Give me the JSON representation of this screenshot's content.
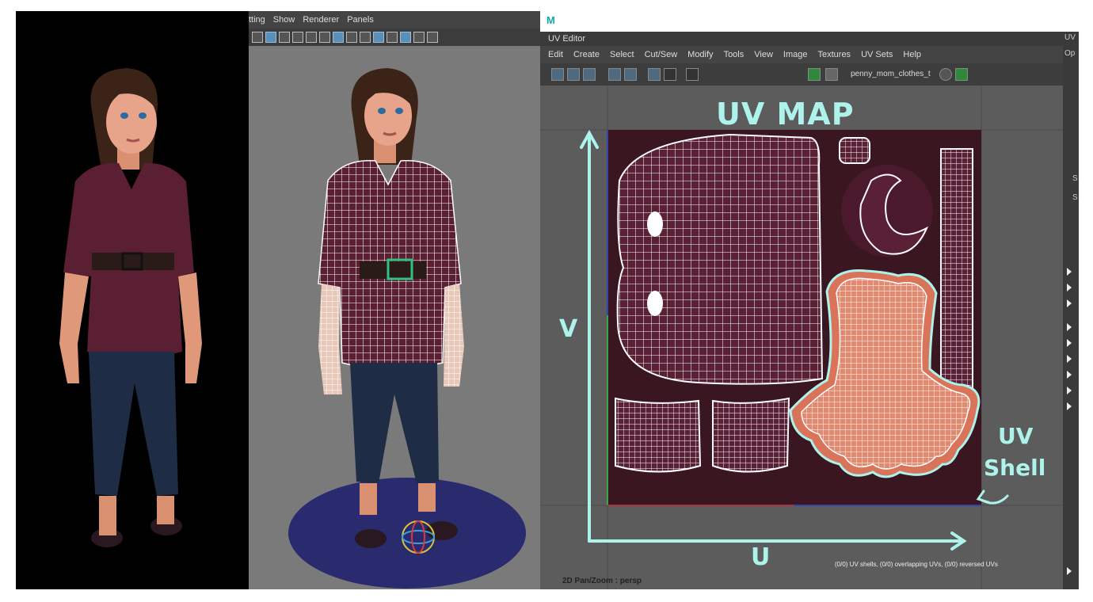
{
  "viewport": {
    "menu": [
      "tting",
      "Show",
      "Renderer",
      "Panels"
    ]
  },
  "uv_editor": {
    "panel_title": "UV Editor",
    "menu": [
      "Edit",
      "Create",
      "Select",
      "Cut/Sew",
      "Modify",
      "Tools",
      "View",
      "Image",
      "Textures",
      "UV Sets",
      "Help"
    ],
    "texture_name": "penny_mom_clothes_t",
    "status": "(0/0) UV shells, (0/0) overlapping UVs, (0/0) reversed UVs",
    "right_labels": [
      "UV",
      "Op",
      "S",
      "S"
    ]
  },
  "annotations": {
    "title": "UV MAP",
    "v_axis": "V",
    "u_axis": "U",
    "shell_label_line1": "UV",
    "shell_label_line2": "Shell"
  },
  "footer": {
    "mode": "2D Pan/Zoom : persp"
  },
  "colors": {
    "shirt": "#5a1f33",
    "jeans": "#1e2c45",
    "skin": "#e8a080",
    "uv_shell_fill": "#d9745a",
    "annotation": "#aef2ec",
    "viewport_bg": "#7a7a7a",
    "ground_disc": "#2a2a6e"
  }
}
